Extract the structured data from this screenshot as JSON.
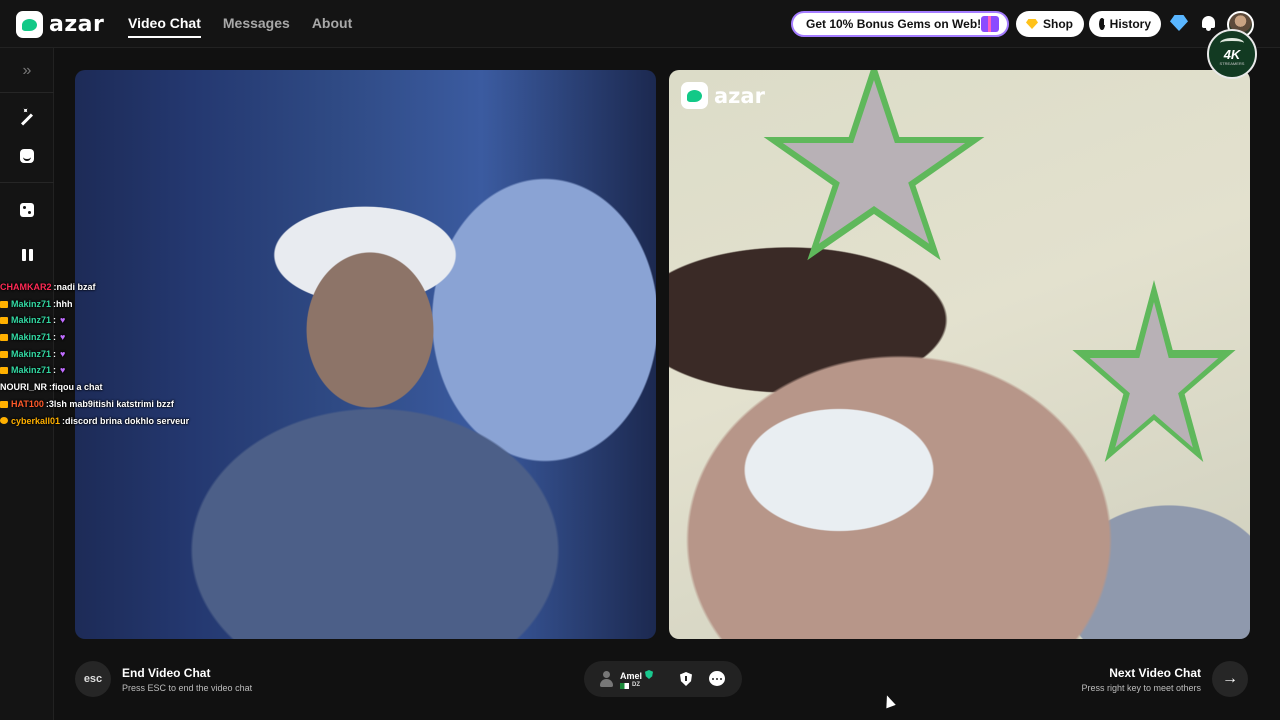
{
  "app": {
    "name": "azar"
  },
  "nav": {
    "items": [
      {
        "label": "Video Chat",
        "active": true
      },
      {
        "label": "Messages",
        "active": false
      },
      {
        "label": "About",
        "active": false
      }
    ]
  },
  "header": {
    "promo_label": "Get 10% Bonus Gems on Web!",
    "shop_label": "Shop",
    "history_label": "History",
    "badge_text": "4K",
    "badge_sub": "STREAMERS"
  },
  "sidebar": {
    "icons": [
      "expand-icon",
      "magic-wand-icon",
      "sticker-icon",
      "dice-icon",
      "pause-icon"
    ]
  },
  "chat": {
    "messages": [
      {
        "user": "CHAMKAR2",
        "text": "nadi bzaf",
        "color": "#ff2a55",
        "badge": false
      },
      {
        "user": "Makinz71",
        "text": "hhh",
        "color": "#33d9a3",
        "badge": true
      },
      {
        "user": "Makinz71",
        "text": "",
        "color": "#33d9a3",
        "badge": true,
        "heart": true
      },
      {
        "user": "Makinz71",
        "text": "",
        "color": "#33d9a3",
        "badge": true,
        "heart": true
      },
      {
        "user": "Makinz71",
        "text": "",
        "color": "#33d9a3",
        "badge": true,
        "heart": true
      },
      {
        "user": "Makinz71",
        "text": "",
        "color": "#33d9a3",
        "badge": true,
        "heart": true
      },
      {
        "user": "NOURI_NR",
        "text": "fiqou a chat",
        "color": "#ffffff",
        "badge": false
      },
      {
        "user": "HAT100",
        "text": "3lsh mab9itishi katstrimi bzzf",
        "color": "#ff5a2a",
        "badge": true
      },
      {
        "user": "cyberkall01",
        "text": "discord brina dokhlo serveur",
        "color": "#ffb000",
        "badge": true,
        "round": true
      }
    ]
  },
  "video": {
    "watermark_text": "azar"
  },
  "controls": {
    "esc_label": "esc",
    "end_title": "End Video Chat",
    "end_sub": "Press ESC to end the video chat",
    "next_title": "Next Video Chat",
    "next_sub": "Press right key to meet others",
    "next_icon": "arrow-right-icon"
  },
  "partner": {
    "name": "Amel",
    "country": "DZ",
    "verified": true
  },
  "colors": {
    "brand": "#12c987",
    "background": "#111111",
    "promo_border": "#a47cff"
  }
}
